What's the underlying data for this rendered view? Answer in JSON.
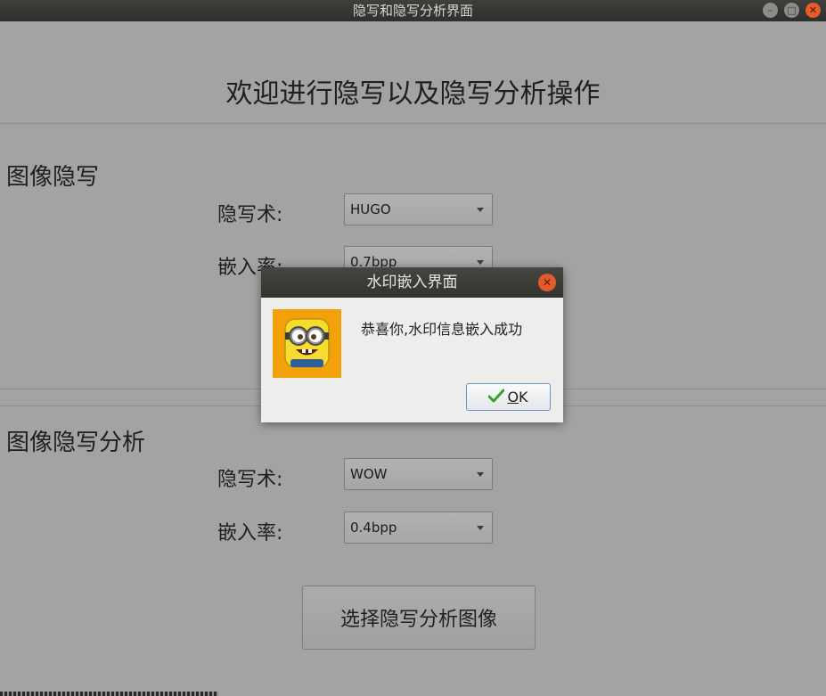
{
  "window": {
    "title": "隐写和隐写分析界面",
    "controls": [
      "minimize-icon",
      "maximize-icon",
      "close-icon"
    ]
  },
  "main": {
    "heading": "欢迎进行隐写以及隐写分析操作",
    "steganography": {
      "title": "图像隐写",
      "algorithm_label": "隐写术:",
      "algorithm_value": "HUGO",
      "rate_label": "嵌入率:",
      "rate_value": "0.7bpp"
    },
    "steganalysis": {
      "title": "图像隐写分析",
      "algorithm_label": "隐写术:",
      "algorithm_value": "WOW",
      "rate_label": "嵌入率:",
      "rate_value": "0.4bpp",
      "select_button": "选择隐写分析图像"
    }
  },
  "dialog": {
    "title": "水印嵌入界面",
    "message": "恭喜你,水印信息嵌入成功",
    "ok_mnemonic": "O",
    "ok_rest": "K",
    "icon": "minion-avatar-icon"
  },
  "colors": {
    "overlay_background": "#a3a3a3",
    "titlebar": "#33332f",
    "close_button": "#e35a2d",
    "avatar_background": "#f3a10b",
    "ok_check": "#3aa027"
  }
}
